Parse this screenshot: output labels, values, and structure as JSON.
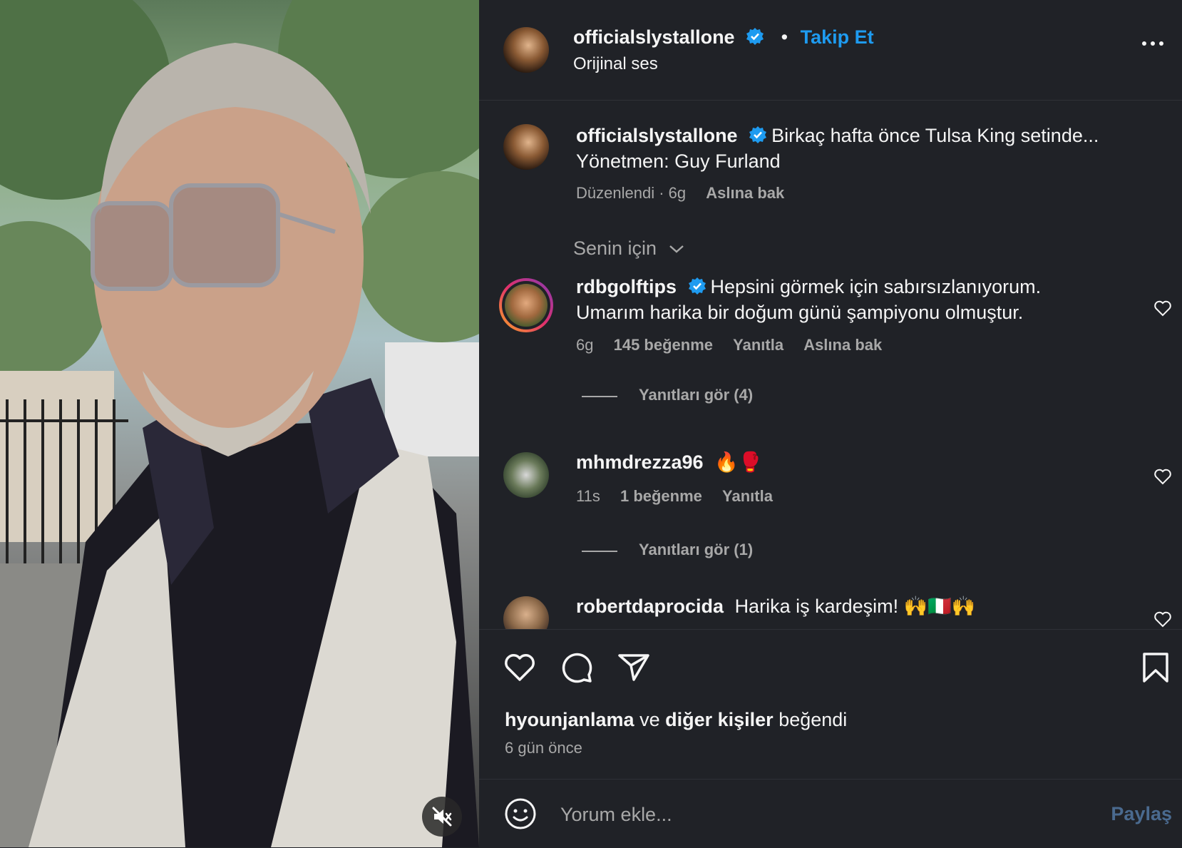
{
  "header": {
    "username": "officialslystallone",
    "separator": "•",
    "follow_label": "Takip Et",
    "audio_label": "Orijinal ses"
  },
  "caption": {
    "username": "officialslystallone",
    "text_line1": "Birkaç hafta önce Tulsa King setinde...",
    "text_line2": "Yönetmen: Guy Furland",
    "edited_time": "Düzenlendi · 6g",
    "see_original": "Aslına bak"
  },
  "sort": {
    "label": "Senin için"
  },
  "comments": [
    {
      "username": "rdbgolftips",
      "text_line1": "Hepsini görmek için sabırsızlanıyorum.",
      "text_line2": "Umarım harika bir doğum günü şampiyonu olmuştur.",
      "time": "6g",
      "likes": "145 beğenme",
      "reply": "Yanıtla",
      "see_original": "Aslına bak",
      "view_replies": "Yanıtları gör (4)"
    },
    {
      "username": "mhmdrezza96",
      "text_line1": "🔥🥊",
      "time": "11s",
      "likes": "1 beğenme",
      "reply": "Yanıtla",
      "view_replies": "Yanıtları gör (1)"
    },
    {
      "username": "robertdaprocida",
      "text_line1": "Harika iş kardeşim! 🙌🇮🇹🙌"
    }
  ],
  "likes_summary": {
    "user": "hyounjanlama",
    "connector": "ve",
    "others": "diğer kişiler",
    "verb": "beğendi",
    "date": "6 gün önce"
  },
  "footer": {
    "placeholder": "Yorum ekle...",
    "share_label": "Paylaş"
  },
  "icons": [
    "heart-icon",
    "comment-icon",
    "share-icon",
    "bookmark-icon",
    "emoji-icon",
    "mute-icon",
    "more-icon",
    "verified-icon",
    "chevron-down-icon"
  ],
  "colors": {
    "background": "#202227",
    "accent": "#1e9bf0",
    "muted": "#a8a8a8",
    "text": "#f5f5f5"
  }
}
